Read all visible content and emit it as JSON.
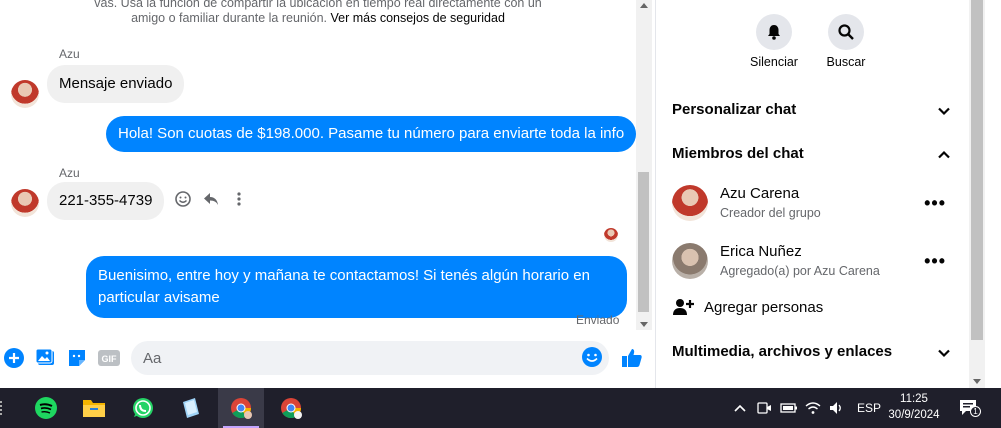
{
  "chat": {
    "safety_notice_line1": "vas. Usa la función de compartir la ubicación en tiempo real directamente con un",
    "safety_notice_line2": "amigo o familiar durante la reunión.",
    "safety_link": "Ver más consejos de seguridad",
    "messages": [
      {
        "sender": "Azu",
        "direction": "incoming",
        "text": "Mensaje enviado"
      },
      {
        "direction": "outgoing",
        "text": "Hola! Son cuotas de $198.000. Pasame tu número para enviarte toda la info"
      },
      {
        "sender": "Azu",
        "direction": "incoming",
        "text": "221-355-4739"
      },
      {
        "direction": "outgoing",
        "text": "Buenisimo, entre hoy y mañana te contactamos! Si tenés algún horario en particular avisame"
      }
    ],
    "status": "Enviado"
  },
  "composer": {
    "placeholder": "Aa"
  },
  "info_panel": {
    "mute_label": "Silenciar",
    "search_label": "Buscar",
    "customize_label": "Personalizar chat",
    "members_label": "Miembros del chat",
    "members": [
      {
        "name": "Azu Carena",
        "role": "Creador del grupo"
      },
      {
        "name": "Erica Nuñez",
        "role": "Agregado(a) por Azu Carena"
      }
    ],
    "more_label": "•••",
    "add_people_label": "Agregar personas",
    "media_label": "Multimedia, archivos y enlaces"
  },
  "taskbar": {
    "language": "ESP",
    "time": "11:25",
    "date": "30/9/2024",
    "notification_count": "1",
    "apps": [
      "spotify-icon",
      "file-explorer-icon",
      "whatsapp-icon",
      "notes-icon",
      "chrome-icon",
      "chrome-profile-icon"
    ]
  },
  "colors": {
    "accent": "#0084ff",
    "incoming_bubble": "#f0f0f0",
    "taskbar": "#1f1f2b"
  }
}
